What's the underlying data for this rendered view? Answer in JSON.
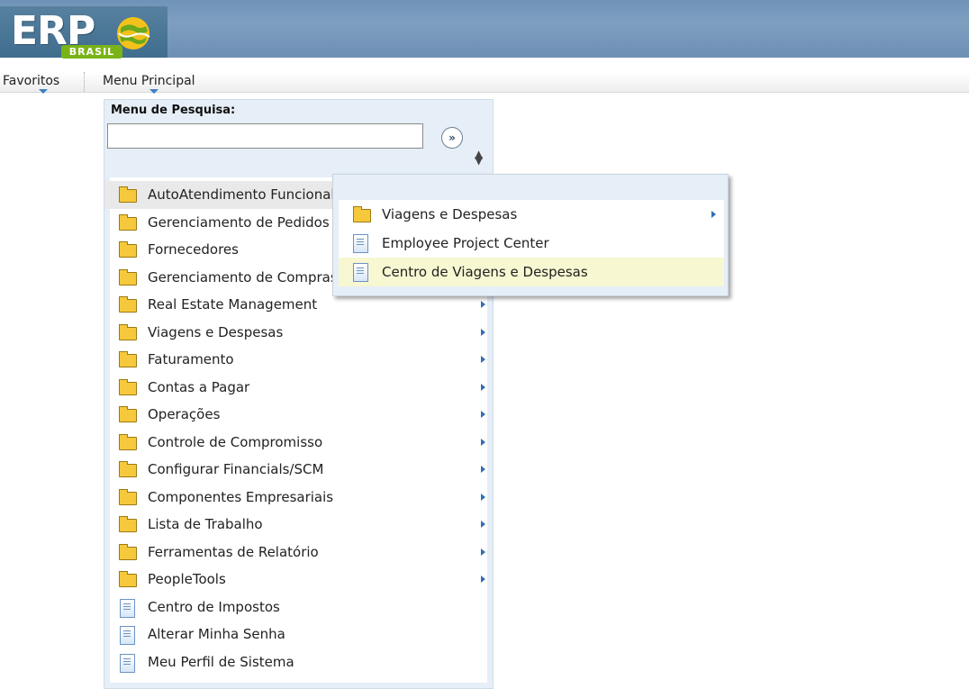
{
  "header": {
    "logo_text": "ERP",
    "logo_sub": "BRASIL"
  },
  "nav": {
    "favorites": "Favoritos",
    "main_menu": "Menu Principal"
  },
  "menu": {
    "search_label": "Menu de Pesquisa:",
    "search_value": "",
    "search_button": "»",
    "items": [
      {
        "label": "AutoAtendimento Funcional",
        "type": "folder",
        "has_submenu": true
      },
      {
        "label": "Gerenciamento de Pedidos",
        "type": "folder",
        "has_submenu": true
      },
      {
        "label": "Fornecedores",
        "type": "folder",
        "has_submenu": true
      },
      {
        "label": "Gerenciamento de Compras",
        "type": "folder",
        "has_submenu": true
      },
      {
        "label": "Real Estate Management",
        "type": "folder",
        "has_submenu": true
      },
      {
        "label": "Viagens e Despesas",
        "type": "folder",
        "has_submenu": true
      },
      {
        "label": "Faturamento",
        "type": "folder",
        "has_submenu": true
      },
      {
        "label": "Contas a Pagar",
        "type": "folder",
        "has_submenu": true
      },
      {
        "label": "Operações",
        "type": "folder",
        "has_submenu": true
      },
      {
        "label": "Controle de Compromisso",
        "type": "folder",
        "has_submenu": true
      },
      {
        "label": "Configurar Financials/SCM",
        "type": "folder",
        "has_submenu": true
      },
      {
        "label": "Componentes Empresariais",
        "type": "folder",
        "has_submenu": true
      },
      {
        "label": "Lista de Trabalho",
        "type": "folder",
        "has_submenu": true
      },
      {
        "label": "Ferramentas de Relatório",
        "type": "folder",
        "has_submenu": true
      },
      {
        "label": "PeopleTools",
        "type": "folder",
        "has_submenu": true
      },
      {
        "label": "Centro de Impostos",
        "type": "page",
        "has_submenu": false
      },
      {
        "label": "Alterar Minha Senha",
        "type": "page",
        "has_submenu": false
      },
      {
        "label": "Meu Perfil de Sistema",
        "type": "page",
        "has_submenu": false
      }
    ]
  },
  "submenu": {
    "items": [
      {
        "label": "Viagens e Despesas",
        "type": "folder",
        "has_submenu": true
      },
      {
        "label": "Employee Project Center",
        "type": "page",
        "has_submenu": false
      },
      {
        "label": "Centro de Viagens e Despesas",
        "type": "page",
        "has_submenu": false,
        "active": true
      }
    ]
  },
  "colors": {
    "banner": "#7f9fc0",
    "menu_panel_bg": "#e6eef7",
    "hover_row": "#e9e9e9",
    "active_row": "#f7f7d2",
    "arrow": "#2f6fb5"
  }
}
